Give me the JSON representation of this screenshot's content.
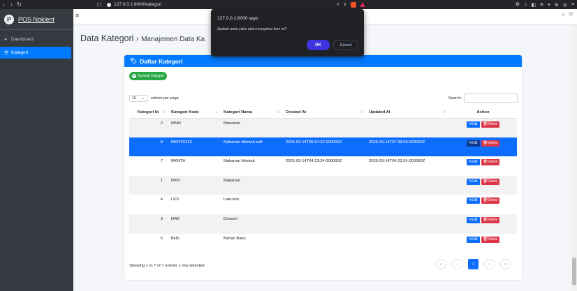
{
  "browser": {
    "url": "127.0.0.1:8000/kategori"
  },
  "sidebar": {
    "brand": "POS Noklent",
    "brand_logo": "P",
    "items": [
      {
        "label": "Dashboard",
        "icon": "dashboard-icon"
      },
      {
        "label": "Kategori",
        "icon": "list-icon",
        "active": true
      }
    ]
  },
  "header": {
    "title": "Data Kategori",
    "separator": "›",
    "subtitle": "Manajemen Data Ka"
  },
  "card": {
    "title": "Daftar Kategori",
    "add_label": "Tambah Kategori",
    "length_value": "10",
    "length_suffix": "entries per page",
    "search_label": "Search:",
    "columns": [
      "Kategori Id",
      "Kategori Kode",
      "Kategori Nama",
      "Created At",
      "Updated At",
      "Action"
    ],
    "rows": [
      {
        "id": "2",
        "kode": "MNM",
        "nama": "Minuman",
        "created": "",
        "updated": "",
        "selected": false
      },
      {
        "id": "8",
        "kode": "MKNTH112",
        "nama": "Makanan Mentah edit",
        "created": "2025-03-14T05:57:32.000000Z",
        "updated": "2025-03-14T07:39:59.000000Z",
        "selected": true
      },
      {
        "id": "7",
        "kode": "MKNTH",
        "nama": "Makanan Mentah",
        "created": "2025-03-14T04:23:24.000000Z",
        "updated": "2025-03-14T04:23:24.000000Z",
        "selected": false
      },
      {
        "id": "1",
        "kode": "MKN",
        "nama": "Makanan",
        "created": "",
        "updated": "",
        "selected": false
      },
      {
        "id": "4",
        "kode": "LKS",
        "nama": "Lain-lain",
        "created": "",
        "updated": "",
        "selected": false
      },
      {
        "id": "3",
        "kode": "DRK",
        "nama": "Dessert",
        "created": "",
        "updated": "",
        "selected": false
      },
      {
        "id": "5",
        "kode": "BHS",
        "nama": "Bahan Baku",
        "created": "",
        "updated": "",
        "selected": false
      }
    ],
    "edit_label": "Edit",
    "delete_label": "Delete",
    "info": "Showing 1 to 7 of 7 entries   1 row selected",
    "pagination": [
      "«",
      "‹",
      "1",
      "›",
      "»"
    ],
    "current_page": "1"
  },
  "dialog": {
    "title": "127.0.0.1:8000 says",
    "message": "Apakah anda yakin akan mengahus item ini?",
    "ok_label": "OK",
    "cancel_label": "Cancel"
  },
  "colors": {
    "primary": "#007bff",
    "success": "#28a745",
    "danger": "#dc3545",
    "sidebar": "#343a40",
    "dialog_ok": "#3f35e0"
  }
}
